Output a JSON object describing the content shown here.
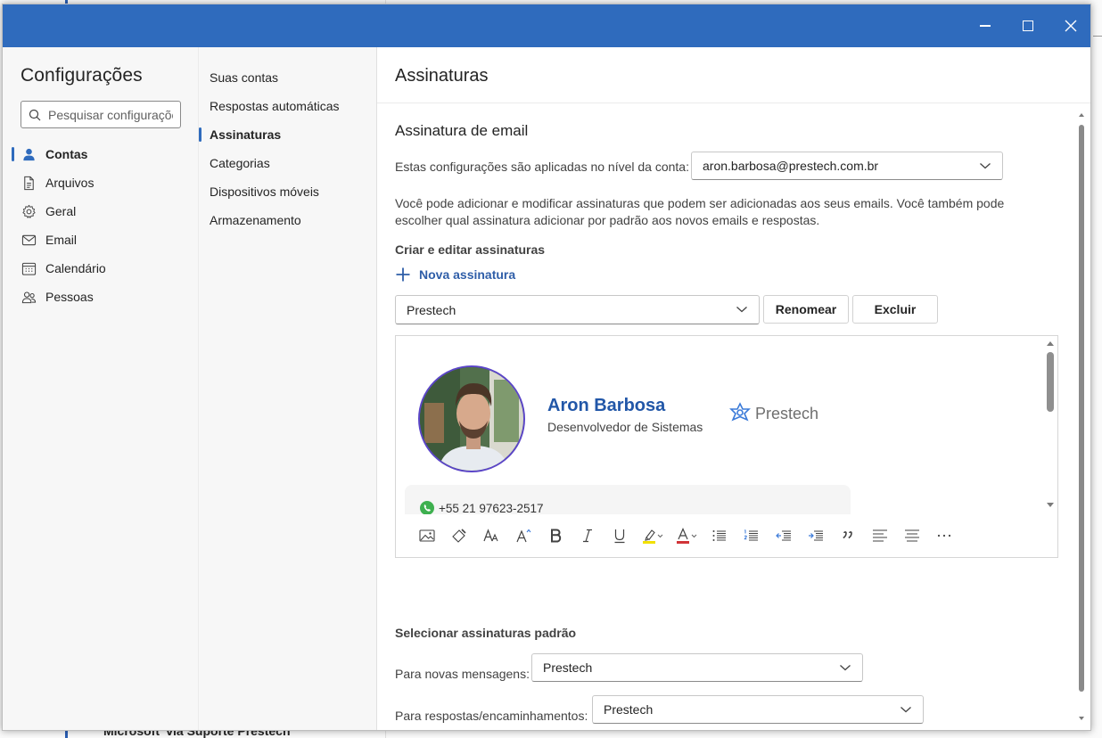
{
  "background": {
    "bottom_text": "Microsoft' via Suporte Prestech"
  },
  "window": {
    "minimize_label": "",
    "maximize_label": "",
    "close_label": ""
  },
  "settings": {
    "title": "Configurações",
    "search_placeholder": "Pesquisar configurações",
    "nav": [
      {
        "label": "Contas",
        "icon": "person-icon",
        "active": true
      },
      {
        "label": "Arquivos",
        "icon": "document-icon",
        "active": false
      },
      {
        "label": "Geral",
        "icon": "gear-icon",
        "active": false
      },
      {
        "label": "Email",
        "icon": "mail-icon",
        "active": false
      },
      {
        "label": "Calendário",
        "icon": "calendar-icon",
        "active": false
      },
      {
        "label": "Pessoas",
        "icon": "people-icon",
        "active": false
      }
    ],
    "subnav": [
      {
        "label": "Suas contas",
        "active": false
      },
      {
        "label": "Respostas automáticas",
        "active": false
      },
      {
        "label": "Assinaturas",
        "active": true
      },
      {
        "label": "Categorias",
        "active": false
      },
      {
        "label": "Dispositivos móveis",
        "active": false
      },
      {
        "label": "Armazenamento",
        "active": false
      }
    ]
  },
  "content": {
    "page_title": "Assinaturas",
    "section_title": "Assinatura de email",
    "account_label": "Estas configurações são aplicadas no nível da conta:",
    "account_value": "aron.barbosa@prestech.com.br",
    "description": "Você pode adicionar e modificar assinaturas que podem ser adicionadas aos seus emails. Você também pode escolher qual assinatura adicionar por padrão aos novos emails e respostas.",
    "create_edit_label": "Criar e editar assinaturas",
    "new_signature_label": "Nova assinatura",
    "signature_select": "Prestech",
    "rename_label": "Renomear",
    "delete_label": "Excluir",
    "signature": {
      "name": "Aron Barbosa",
      "role": "Desenvolvedor de Sistemas",
      "company": "Prestech",
      "phone": "+55 21 97623-2517"
    },
    "toolbar": [
      "insert-image-icon",
      "format-painter-icon",
      "font-size-icon",
      "font-grow-icon",
      "bold-icon",
      "italic-icon",
      "underline-icon",
      "highlight-icon",
      "font-color-icon",
      "bullets-icon",
      "numbering-icon",
      "decrease-indent-icon",
      "increase-indent-icon",
      "quote-icon",
      "align-left-icon",
      "align-center-icon",
      "more-icon"
    ],
    "defaults_title": "Selecionar assinaturas padrão",
    "new_messages_label": "Para novas mensagens:",
    "new_messages_value": "Prestech",
    "replies_label": "Para respostas/encaminhamentos:",
    "replies_value": "Prestech"
  },
  "colors": {
    "accent": "#2f6bbd",
    "link": "#2f5ea8",
    "signature_name": "#2257a8",
    "avatar_ring": "#5b45c8"
  }
}
